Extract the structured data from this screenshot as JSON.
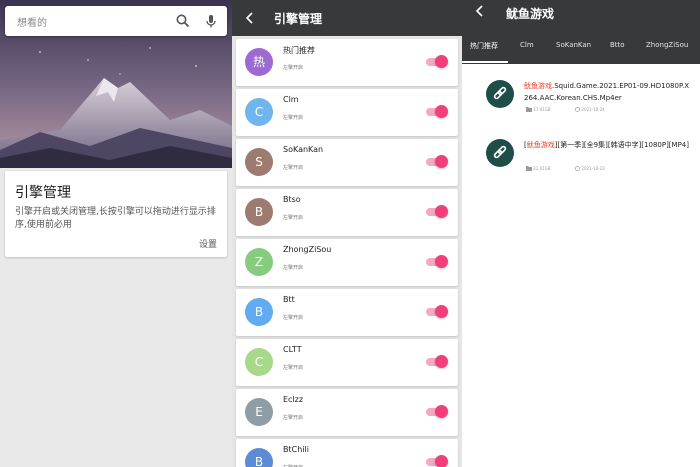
{
  "panel1": {
    "search_placeholder": "想看的",
    "search_icon": "search-icon",
    "mic_icon": "mic-icon",
    "card": {
      "title": "引擎管理",
      "description": "引擎开启或关闭管理,长按引擎可以拖动进行显示排序,使用前必用",
      "settings_link": "设置"
    }
  },
  "panel2": {
    "title": "引擎管理",
    "back_icon": "back-arrow-icon",
    "engines": [
      {
        "initial": "热",
        "name": "热门推荐",
        "status": "左擎开启",
        "color": "#9c6ad1",
        "enabled": true
      },
      {
        "initial": "C",
        "name": "Clm",
        "status": "左擎开启",
        "color": "#6fb6ee",
        "enabled": true
      },
      {
        "initial": "S",
        "name": "SoKanKan",
        "status": "左擎开启",
        "color": "#9d7b70",
        "enabled": true
      },
      {
        "initial": "B",
        "name": "Btso",
        "status": "左擎开启",
        "color": "#9d7b70",
        "enabled": true
      },
      {
        "initial": "Z",
        "name": "ZhongZiSou",
        "status": "左擎开启",
        "color": "#86cb80",
        "enabled": true
      },
      {
        "initial": "B",
        "name": "Btt",
        "status": "左擎开启",
        "color": "#62abf0",
        "enabled": true
      },
      {
        "initial": "C",
        "name": "CLTT",
        "status": "左擎开启",
        "color": "#a8d88a",
        "enabled": true
      },
      {
        "initial": "E",
        "name": "Eclzz",
        "status": "左擎开启",
        "color": "#8f9ea6",
        "enabled": true
      },
      {
        "initial": "B",
        "name": "BtChili",
        "status": "左擎开启",
        "color": "#5c8bd8",
        "enabled": true
      }
    ]
  },
  "panel3": {
    "title": "鱿鱼游戏",
    "back_icon": "back-arrow-icon",
    "tabs": [
      "热门推荐",
      "Clm",
      "SoKanKan",
      "Btto",
      "ZhongZiSou"
    ],
    "active_tab": 0,
    "results": [
      {
        "highlight": "鱿鱼游戏",
        "title_rest": ".Squid.Game.2021.EP01-09.HD1080P.X264.AAC.Korean.CHS.Mp4er",
        "size": "17.01GB",
        "date": "2021-10-24"
      },
      {
        "prefix": "[",
        "highlight": "鱿鱼游戏",
        "title_rest": "][第一季][全9集][韩语中字][1080P][MP4]",
        "size": "22.61GB",
        "date": "2021-10-23"
      }
    ],
    "link_icon": "link-icon",
    "folder_icon": "folder-icon",
    "clock_icon": "clock-icon",
    "accent_color": "#e8432e"
  }
}
